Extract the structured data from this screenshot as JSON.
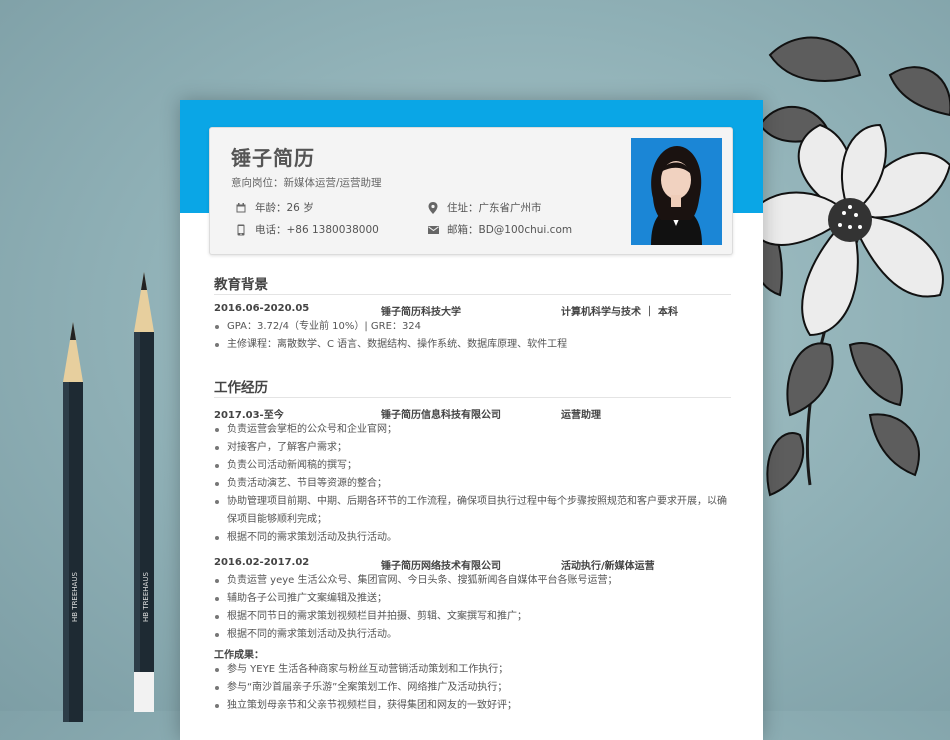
{
  "resume": {
    "name": "锤子简历",
    "intent": "意向岗位：新媒体运营/运营助理",
    "age": "年龄：26 岁",
    "address": "住址：广东省广州市",
    "phone": "电话：+86 1380038000",
    "email": "邮箱：BD@100chui.com"
  },
  "education": {
    "title": "教育背景",
    "period": "2016.06-2020.05",
    "school": "锤子简历科技大学",
    "major": "计算机科学与技术 ｜ 本科",
    "bullets": [
      "GPA：3.72/4（专业前 10%）| GRE：324",
      "主修课程：离散数学、C 语言、数据结构、操作系统、数据库原理、软件工程"
    ]
  },
  "work": {
    "title": "工作经历",
    "jobs": [
      {
        "period": "2017.03-至今",
        "company": "锤子简历信息科技有限公司",
        "role": "运营助理",
        "bullets": [
          "负责运营会掌柜的公众号和企业官网；",
          "对接客户，了解客户需求；",
          "负责公司活动新闻稿的撰写；",
          "负责活动演艺、节目等资源的整合；",
          "协助管理项目前期、中期、后期各环节的工作流程，确保项目执行过程中每个步骤按照规范和客户要求开展，以确保项目能够顺利完成；",
          "根据不同的需求策划活动及执行活动。"
        ]
      },
      {
        "period": "2016.02-2017.02",
        "company": "锤子简历网络技术有限公司",
        "role": "活动执行/新媒体运营",
        "bullets": [
          "负责运营 yeye 生活公众号、集团官网、今日头条、搜狐新闻各自媒体平台各账号运营；",
          "辅助各子公司推广文案编辑及推送；",
          "根据不同节日的需求策划视频栏目并拍摄、剪辑、文案撰写和推广；",
          "根据不同的需求策划活动及执行活动。"
        ],
        "achievements_label": "工作成果：",
        "achievements": [
          "参与 YEYE 生活各种商家与粉丝互动营销活动策划和工作执行；",
          "参与“南沙首届亲子乐游”全案策划工作、网络推广及活动执行；",
          "独立策划母亲节和父亲节视频栏目，获得集团和网友的一致好评；"
        ]
      }
    ]
  },
  "colors": {
    "accent": "#0aa6e6",
    "background": "#8fb0b6"
  },
  "icons": [
    "calendar-icon",
    "location-icon",
    "phone-icon",
    "mail-icon",
    "flower-decoration",
    "pencil"
  ]
}
